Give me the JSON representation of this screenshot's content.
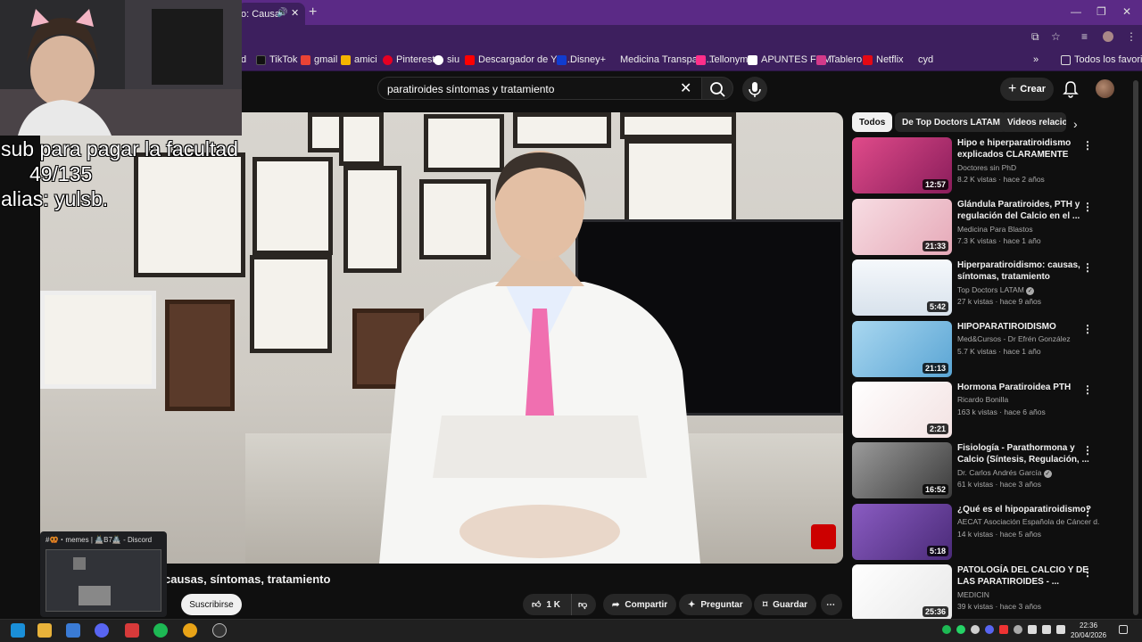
{
  "browser": {
    "tab_title": "o: Causa",
    "new_tab": "+",
    "window_controls": [
      "—",
      "❐",
      "✕"
    ]
  },
  "bookmarks": {
    "items": [
      {
        "label": "d",
        "color": "#999999"
      },
      {
        "label": "TikTok",
        "color": "#111111"
      },
      {
        "label": "gmail",
        "color": "#ea4335"
      },
      {
        "label": "amici",
        "color": "#f4b400"
      },
      {
        "label": "Pinterest",
        "color": "#e60023"
      },
      {
        "label": "siu",
        "color": "#ffffff"
      },
      {
        "label": "Descargador de You...",
        "color": "#ff0000"
      },
      {
        "label": "Disney+",
        "color": "#113ccf"
      },
      {
        "label": "Medicina Transpare...",
        "color": "#4a6fa5"
      },
      {
        "label": "Tellonym",
        "color": "#ff2e8a"
      },
      {
        "label": "APUNTES FCM",
        "color": "#ffffff"
      },
      {
        "label": "Tablero",
        "color": "#d33a8a"
      },
      {
        "label": "Netflix",
        "color": "#e50914"
      },
      {
        "label": "cyd",
        "color": "#777777"
      }
    ],
    "more": "»",
    "all_favorites": "Todos los favoritos"
  },
  "youtube": {
    "search_value": "paratiroides síntomas y tratamiento",
    "create_label": "Crear",
    "video_title": "causas, síntomas, tratamiento",
    "subscribe_label": "Suscribirse",
    "actions": {
      "likes": "1 K",
      "share": "Compartir",
      "ask": "Preguntar",
      "save": "Guardar"
    },
    "chips": [
      "Todos",
      "De Top Doctors LATAM",
      "Videos relacio"
    ],
    "recommendations": [
      {
        "title": "Hipo e hiperparatiroidismo explicados CLARAMENTE",
        "channel": "Doctores sin PhD",
        "meta": "8.2 K vistas · hace 2 años",
        "duration": "12:57",
        "thumb": "#c22f74",
        "verified": false
      },
      {
        "title": "Glándula Paratiroides, PTH y regulación del Calcio en el ...",
        "channel": "Medicina Para Blastos",
        "meta": "7.3 K vistas · hace 1 año",
        "duration": "21:33",
        "thumb": "#f0c6cf",
        "verified": false
      },
      {
        "title": "Hiperparatiroidismo: causas, síntomas, tratamiento",
        "channel": "Top Doctors LATAM",
        "meta": "27 k vistas · hace 9 años",
        "duration": "5:42",
        "thumb": "#e9eef4",
        "verified": true
      },
      {
        "title": "HIPOPARATIROIDISMO",
        "channel": "Med&Cursos - Dr Efrén González",
        "meta": "5.7 K vistas · hace 1 año",
        "duration": "21:13",
        "thumb": "#8fc7e8",
        "verified": false
      },
      {
        "title": "Hormona Paratiroidea PTH",
        "channel": "Ricardo Bonilla",
        "meta": "163 k vistas · hace 6 años",
        "duration": "2:21",
        "thumb": "#f7f1f1",
        "verified": false
      },
      {
        "title": "Fisiología - Parathormona y Calcio (Síntesis, Regulación, ...",
        "channel": "Dr. Carlos Andrés García",
        "meta": "61 k vistas · hace 3 años",
        "duration": "16:52",
        "thumb": "#6c6c6c",
        "verified": true
      },
      {
        "title": "¿Qué es el hipoparatiroidismo?",
        "channel": "AECAT Asociación Española de Cáncer d...",
        "meta": "14 k vistas · hace 5 años",
        "duration": "5:18",
        "thumb": "#6b3fa0",
        "verified": false
      },
      {
        "title": "PATOLOGÍA DEL CALCIO Y DE LAS PARATIROIDES - ...",
        "channel": "MEDICIN",
        "meta": "39 k vistas · hace 3 años",
        "duration": "25:36",
        "thumb": "#f3f3f3",
        "verified": false
      }
    ]
  },
  "overlay": {
    "stream_text": "sub para pagar la facultad\n     49/135\nalias: yulsb.",
    "discord_title": "#🥨・memes | 🏯B7🏯 - Discord"
  },
  "taskbar": {
    "time": "22:36",
    "date": "20/04/2026"
  }
}
